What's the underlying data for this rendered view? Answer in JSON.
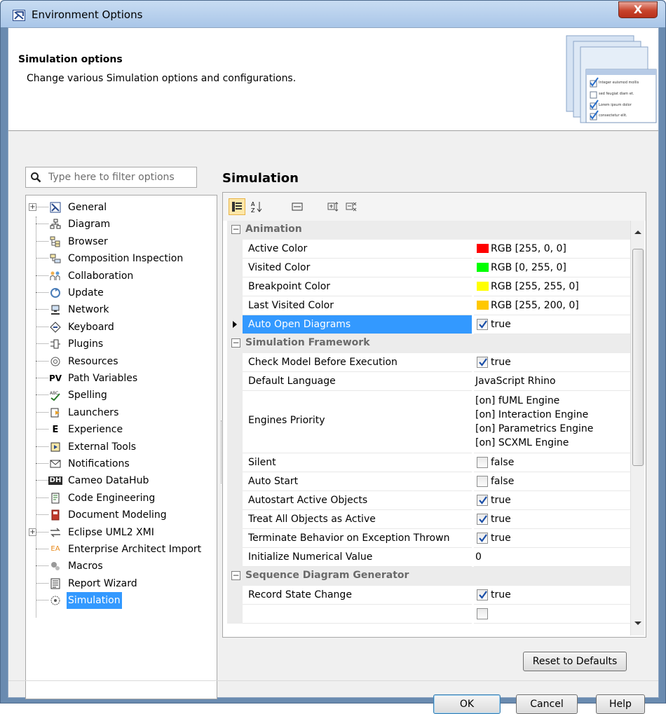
{
  "window": {
    "title": "Environment Options",
    "close_label": "X"
  },
  "header": {
    "title": "Simulation options",
    "description": "Change various Simulation options and configurations.",
    "art_items": [
      "Integer euismod mollis",
      "sed feugiat diam et.",
      "Lorem ipsum dolor",
      "consectetur elit."
    ]
  },
  "filter": {
    "placeholder": "Type here to filter options",
    "value": ""
  },
  "tree": {
    "items": [
      {
        "label": "General",
        "icon": "general-icon",
        "expandable": true
      },
      {
        "label": "Diagram",
        "icon": "diagram-icon"
      },
      {
        "label": "Browser",
        "icon": "browser-icon"
      },
      {
        "label": "Composition Inspection",
        "icon": "composition-icon"
      },
      {
        "label": "Collaboration",
        "icon": "collaboration-icon"
      },
      {
        "label": "Update",
        "icon": "update-icon"
      },
      {
        "label": "Network",
        "icon": "network-icon"
      },
      {
        "label": "Keyboard",
        "icon": "keyboard-icon"
      },
      {
        "label": "Plugins",
        "icon": "plugins-icon"
      },
      {
        "label": "Resources",
        "icon": "resources-icon"
      },
      {
        "label": "Path Variables",
        "icon": "path-variables-icon"
      },
      {
        "label": "Spelling",
        "icon": "spelling-icon"
      },
      {
        "label": "Launchers",
        "icon": "launchers-icon"
      },
      {
        "label": "Experience",
        "icon": "experience-icon"
      },
      {
        "label": "External Tools",
        "icon": "external-tools-icon"
      },
      {
        "label": "Notifications",
        "icon": "notifications-icon"
      },
      {
        "label": "Cameo DataHub",
        "icon": "datahub-icon"
      },
      {
        "label": "Code Engineering",
        "icon": "code-engineering-icon"
      },
      {
        "label": "Document Modeling",
        "icon": "document-modeling-icon"
      },
      {
        "label": "Eclipse UML2 XMI",
        "icon": "eclipse-icon",
        "expandable": true
      },
      {
        "label": "Enterprise Architect Import",
        "icon": "ea-import-icon"
      },
      {
        "label": "Macros",
        "icon": "macros-icon"
      },
      {
        "label": "Report Wizard",
        "icon": "report-wizard-icon"
      },
      {
        "label": "Simulation",
        "icon": "simulation-icon",
        "selected": true
      }
    ],
    "glyphs": {
      "pv": "PV",
      "e": "E",
      "dh": "DH",
      "ea": "EA"
    }
  },
  "panel": {
    "title": "Simulation"
  },
  "groups": {
    "animation": "Animation",
    "framework": "Simulation Framework",
    "sequence": "Sequence Diagram Generator"
  },
  "props": {
    "active_color": {
      "name": "Active Color",
      "value": "RGB [255, 0, 0]",
      "color": "#ff0000"
    },
    "visited_color": {
      "name": "Visited Color",
      "value": "RGB [0, 255, 0]",
      "color": "#00ff00"
    },
    "breakpoint_color": {
      "name": "Breakpoint Color",
      "value": "RGB [255, 255, 0]",
      "color": "#ffff00"
    },
    "last_visited_color": {
      "name": "Last Visited Color",
      "value": "RGB [255, 200, 0]",
      "color": "#ffc800"
    },
    "auto_open": {
      "name": "Auto Open Diagrams",
      "value": "true",
      "checked": true
    },
    "check_model": {
      "name": "Check Model Before Execution",
      "value": "true",
      "checked": true
    },
    "default_language": {
      "name": "Default Language",
      "value": "JavaScript Rhino"
    },
    "engines_priority": {
      "name": "Engines Priority",
      "values": [
        "[on] fUML Engine",
        "[on] Interaction Engine",
        "[on] Parametrics Engine",
        "[on] SCXML Engine"
      ]
    },
    "silent": {
      "name": "Silent",
      "value": "false",
      "checked": false
    },
    "auto_start": {
      "name": "Auto Start",
      "value": "false",
      "checked": false
    },
    "autostart_active": {
      "name": "Autostart Active Objects",
      "value": "true",
      "checked": true
    },
    "treat_all_active": {
      "name": "Treat All Objects as Active",
      "value": "true",
      "checked": true
    },
    "terminate_behavior": {
      "name": "Terminate Behavior on Exception Thrown",
      "value": "true",
      "checked": true
    },
    "init_numerical": {
      "name": "Initialize Numerical Value",
      "value": "0"
    },
    "record_state": {
      "name": "Record State Change",
      "value": "true",
      "checked": true
    }
  },
  "buttons": {
    "reset": "Reset to Defaults",
    "ok": "OK",
    "cancel": "Cancel",
    "help": "Help"
  }
}
